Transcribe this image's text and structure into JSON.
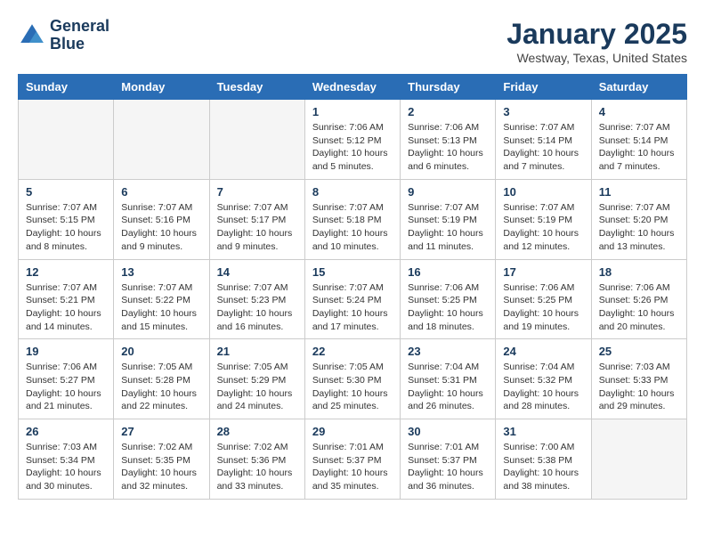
{
  "header": {
    "logo_line1": "General",
    "logo_line2": "Blue",
    "month_title": "January 2025",
    "location": "Westway, Texas, United States"
  },
  "weekdays": [
    "Sunday",
    "Monday",
    "Tuesday",
    "Wednesday",
    "Thursday",
    "Friday",
    "Saturday"
  ],
  "weeks": [
    [
      {
        "day": "",
        "empty": true
      },
      {
        "day": "",
        "empty": true
      },
      {
        "day": "",
        "empty": true
      },
      {
        "day": "1",
        "sunrise": "7:06 AM",
        "sunset": "5:12 PM",
        "daylight": "10 hours and 5 minutes."
      },
      {
        "day": "2",
        "sunrise": "7:06 AM",
        "sunset": "5:13 PM",
        "daylight": "10 hours and 6 minutes."
      },
      {
        "day": "3",
        "sunrise": "7:07 AM",
        "sunset": "5:14 PM",
        "daylight": "10 hours and 7 minutes."
      },
      {
        "day": "4",
        "sunrise": "7:07 AM",
        "sunset": "5:14 PM",
        "daylight": "10 hours and 7 minutes."
      }
    ],
    [
      {
        "day": "5",
        "sunrise": "7:07 AM",
        "sunset": "5:15 PM",
        "daylight": "10 hours and 8 minutes."
      },
      {
        "day": "6",
        "sunrise": "7:07 AM",
        "sunset": "5:16 PM",
        "daylight": "10 hours and 9 minutes."
      },
      {
        "day": "7",
        "sunrise": "7:07 AM",
        "sunset": "5:17 PM",
        "daylight": "10 hours and 9 minutes."
      },
      {
        "day": "8",
        "sunrise": "7:07 AM",
        "sunset": "5:18 PM",
        "daylight": "10 hours and 10 minutes."
      },
      {
        "day": "9",
        "sunrise": "7:07 AM",
        "sunset": "5:19 PM",
        "daylight": "10 hours and 11 minutes."
      },
      {
        "day": "10",
        "sunrise": "7:07 AM",
        "sunset": "5:19 PM",
        "daylight": "10 hours and 12 minutes."
      },
      {
        "day": "11",
        "sunrise": "7:07 AM",
        "sunset": "5:20 PM",
        "daylight": "10 hours and 13 minutes."
      }
    ],
    [
      {
        "day": "12",
        "sunrise": "7:07 AM",
        "sunset": "5:21 PM",
        "daylight": "10 hours and 14 minutes."
      },
      {
        "day": "13",
        "sunrise": "7:07 AM",
        "sunset": "5:22 PM",
        "daylight": "10 hours and 15 minutes."
      },
      {
        "day": "14",
        "sunrise": "7:07 AM",
        "sunset": "5:23 PM",
        "daylight": "10 hours and 16 minutes."
      },
      {
        "day": "15",
        "sunrise": "7:07 AM",
        "sunset": "5:24 PM",
        "daylight": "10 hours and 17 minutes."
      },
      {
        "day": "16",
        "sunrise": "7:06 AM",
        "sunset": "5:25 PM",
        "daylight": "10 hours and 18 minutes."
      },
      {
        "day": "17",
        "sunrise": "7:06 AM",
        "sunset": "5:25 PM",
        "daylight": "10 hours and 19 minutes."
      },
      {
        "day": "18",
        "sunrise": "7:06 AM",
        "sunset": "5:26 PM",
        "daylight": "10 hours and 20 minutes."
      }
    ],
    [
      {
        "day": "19",
        "sunrise": "7:06 AM",
        "sunset": "5:27 PM",
        "daylight": "10 hours and 21 minutes."
      },
      {
        "day": "20",
        "sunrise": "7:05 AM",
        "sunset": "5:28 PM",
        "daylight": "10 hours and 22 minutes."
      },
      {
        "day": "21",
        "sunrise": "7:05 AM",
        "sunset": "5:29 PM",
        "daylight": "10 hours and 24 minutes."
      },
      {
        "day": "22",
        "sunrise": "7:05 AM",
        "sunset": "5:30 PM",
        "daylight": "10 hours and 25 minutes."
      },
      {
        "day": "23",
        "sunrise": "7:04 AM",
        "sunset": "5:31 PM",
        "daylight": "10 hours and 26 minutes."
      },
      {
        "day": "24",
        "sunrise": "7:04 AM",
        "sunset": "5:32 PM",
        "daylight": "10 hours and 28 minutes."
      },
      {
        "day": "25",
        "sunrise": "7:03 AM",
        "sunset": "5:33 PM",
        "daylight": "10 hours and 29 minutes."
      }
    ],
    [
      {
        "day": "26",
        "sunrise": "7:03 AM",
        "sunset": "5:34 PM",
        "daylight": "10 hours and 30 minutes."
      },
      {
        "day": "27",
        "sunrise": "7:02 AM",
        "sunset": "5:35 PM",
        "daylight": "10 hours and 32 minutes."
      },
      {
        "day": "28",
        "sunrise": "7:02 AM",
        "sunset": "5:36 PM",
        "daylight": "10 hours and 33 minutes."
      },
      {
        "day": "29",
        "sunrise": "7:01 AM",
        "sunset": "5:37 PM",
        "daylight": "10 hours and 35 minutes."
      },
      {
        "day": "30",
        "sunrise": "7:01 AM",
        "sunset": "5:37 PM",
        "daylight": "10 hours and 36 minutes."
      },
      {
        "day": "31",
        "sunrise": "7:00 AM",
        "sunset": "5:38 PM",
        "daylight": "10 hours and 38 minutes."
      },
      {
        "day": "",
        "empty": true
      }
    ]
  ],
  "labels": {
    "sunrise_prefix": "Sunrise: ",
    "sunset_prefix": "Sunset: ",
    "daylight_prefix": "Daylight: "
  }
}
